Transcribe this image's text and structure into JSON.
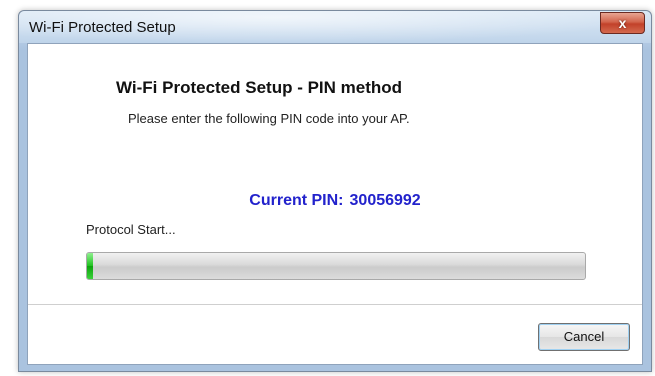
{
  "window": {
    "title": "Wi-Fi Protected Setup",
    "close_glyph": "x"
  },
  "content": {
    "heading": "Wi-Fi Protected Setup - PIN method",
    "instruction": "Please enter the following PIN code into your AP.",
    "pin_label": "Current PIN:",
    "pin_value": "30056992",
    "status": "Protocol Start..."
  },
  "progress": {
    "fraction": 0.012
  },
  "buttons": {
    "cancel": "Cancel"
  },
  "colors": {
    "pin_text": "#2222cc",
    "progress_fill": "#1fc21f",
    "close_button": "#c2412a"
  },
  "icons": {
    "close": "close-icon"
  }
}
